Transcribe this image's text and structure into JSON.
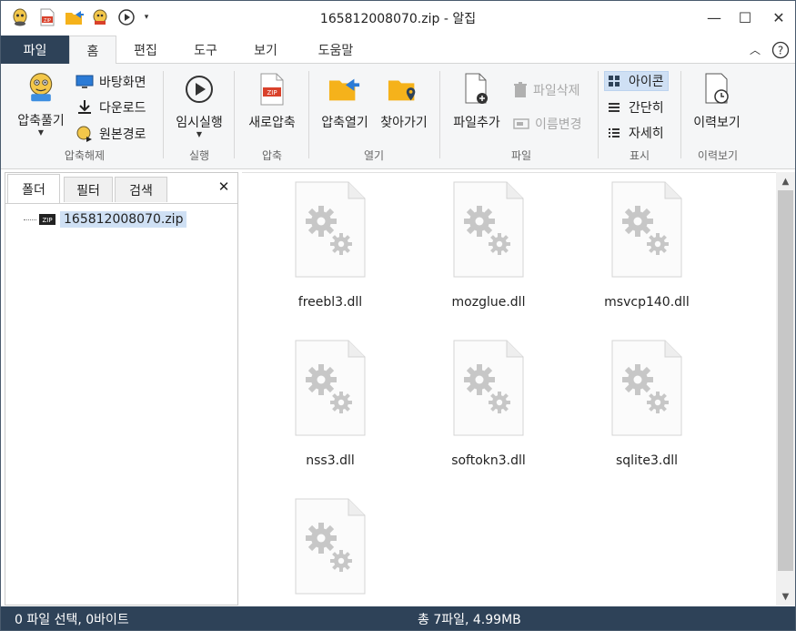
{
  "window": {
    "title": "165812008070.zip - 알집",
    "minimize": "—",
    "maximize": "☐",
    "close": "✕"
  },
  "tabs": {
    "file": "파일",
    "items": [
      "홈",
      "편집",
      "도구",
      "보기",
      "도움말"
    ],
    "active": "홈"
  },
  "ribbon": {
    "extract": {
      "unzip_label": "압축풀기",
      "desktop_label": "바탕화면",
      "download_label": "다운로드",
      "original_label": "원본경로",
      "group_label": "압축해제"
    },
    "run": {
      "temp_run_label": "임시실행",
      "group_label": "실행"
    },
    "compress": {
      "new_label": "새로압축",
      "group_label": "압축"
    },
    "open": {
      "open_label": "압축열기",
      "find_label": "찾아가기",
      "group_label": "열기"
    },
    "file": {
      "add_label": "파일추가",
      "delete_label": "파일삭제",
      "rename_label": "이름변경",
      "group_label": "파일"
    },
    "view": {
      "icon_label": "아이콘",
      "simple_label": "간단히",
      "detail_label": "자세히",
      "group_label": "표시"
    },
    "history": {
      "label": "이력보기",
      "group_label": "이력보기"
    }
  },
  "leftpanel": {
    "tabs": [
      "폴더",
      "필터",
      "검색"
    ],
    "close": "✕",
    "tree_root": "165812008070.zip"
  },
  "files": [
    {
      "name": "freebl3.dll"
    },
    {
      "name": "mozglue.dll"
    },
    {
      "name": "msvcp140.dll"
    },
    {
      "name": "nss3.dll"
    },
    {
      "name": "softokn3.dll"
    },
    {
      "name": "sqlite3.dll"
    },
    {
      "name": ""
    }
  ],
  "status": {
    "left": "0 파일 선택, 0바이트",
    "center": "총 7파일, 4.99MB"
  },
  "colors": {
    "accent": "#2e4258",
    "selection": "#cfe0f4",
    "zip_red": "#d9412b",
    "folder": "#f5b21b"
  }
}
